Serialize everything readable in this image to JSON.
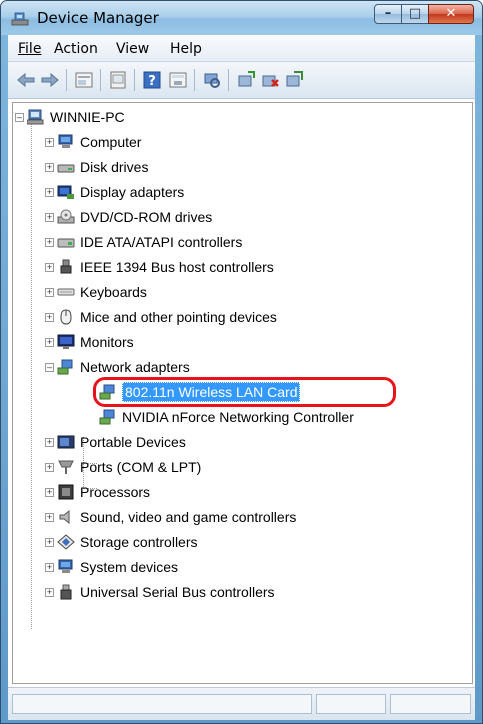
{
  "window": {
    "title": "Device Manager",
    "caption_buttons": {
      "minimize": "–",
      "maximize": "□",
      "close": "✕"
    }
  },
  "menu": [
    {
      "label": "File",
      "accel": "F"
    },
    {
      "label": "Action",
      "accel": "A"
    },
    {
      "label": "View",
      "accel": "V"
    },
    {
      "label": "Help",
      "accel": "H"
    }
  ],
  "toolbar": {
    "buttons": [
      "back-arrow-icon",
      "forward-arrow-icon",
      "properties-icon",
      "show-hidden-icon",
      "help-icon",
      "scan-hardware-icon",
      "update-driver-icon",
      "disable-device-icon",
      "uninstall-icon",
      "rollback-icon"
    ]
  },
  "tree": {
    "root": "WINNIE-PC",
    "categories": [
      {
        "label": "Computer",
        "icon": "computer-icon"
      },
      {
        "label": "Disk drives",
        "icon": "disk-drive-icon"
      },
      {
        "label": "Display adapters",
        "icon": "display-adapter-icon"
      },
      {
        "label": "DVD/CD-ROM drives",
        "icon": "dvd-drive-icon"
      },
      {
        "label": "IDE ATA/ATAPI controllers",
        "icon": "ide-controller-icon"
      },
      {
        "label": "IEEE 1394 Bus host controllers",
        "icon": "firewire-icon"
      },
      {
        "label": "Keyboards",
        "icon": "keyboard-icon"
      },
      {
        "label": "Mice and other pointing devices",
        "icon": "mouse-icon"
      },
      {
        "label": "Monitors",
        "icon": "monitor-icon"
      },
      {
        "label": "Network adapters",
        "icon": "network-adapter-icon",
        "expanded": true,
        "children": [
          {
            "label": "802.11n Wireless LAN Card",
            "selected": true
          },
          {
            "label": "NVIDIA nForce Networking Controller"
          }
        ]
      },
      {
        "label": "Portable Devices",
        "icon": "portable-device-icon"
      },
      {
        "label": "Ports (COM & LPT)",
        "icon": "port-icon"
      },
      {
        "label": "Processors",
        "icon": "processor-icon"
      },
      {
        "label": "Sound, video and game controllers",
        "icon": "speaker-icon"
      },
      {
        "label": "Storage controllers",
        "icon": "storage-controller-icon"
      },
      {
        "label": "System devices",
        "icon": "system-device-icon"
      },
      {
        "label": "Universal Serial Bus controllers",
        "icon": "usb-icon"
      }
    ]
  },
  "colors": {
    "selection": "#3399ff",
    "annotation_ring": "#e8121a"
  }
}
